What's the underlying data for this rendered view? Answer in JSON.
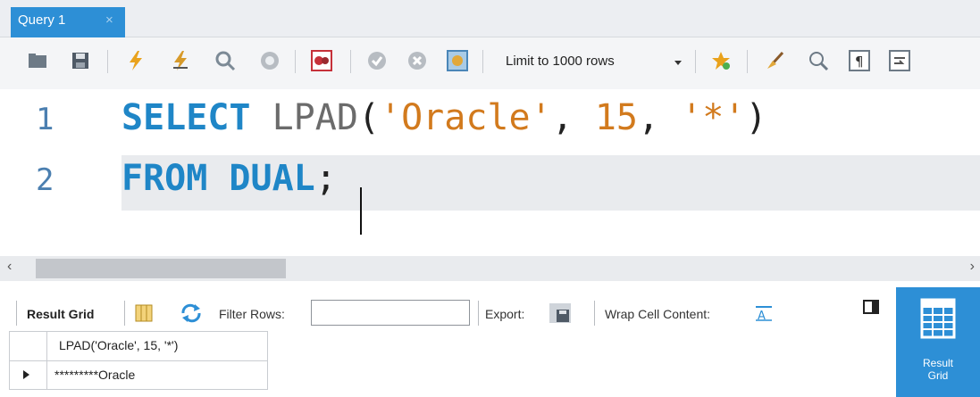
{
  "tab": {
    "title": "Query 1",
    "close_glyph": "×"
  },
  "toolbar": {
    "icons": [
      "folder-open-icon",
      "save-icon",
      "execute-icon",
      "execute-current-icon",
      "explain-icon",
      "stop-icon",
      "toggle-error-icon",
      "commit-icon",
      "rollback-icon",
      "autocommit-icon",
      "favorite-snippet-icon",
      "beautify-icon",
      "find-icon",
      "invisible-chars-icon",
      "wrap-icon"
    ],
    "limit_select": "Limit to 1000 rows"
  },
  "editor": {
    "lines": [
      {
        "number": "1",
        "kw1": "SELECT",
        "fn": "LPAD",
        "p1": "(",
        "s1": "'Oracle'",
        "c1": ", ",
        "n1": "15",
        "c2": ", ",
        "s2": "'*'",
        "p2": ")"
      },
      {
        "number": "2",
        "kw1": "FROM",
        "kw2": "DUAL",
        "p1": ";"
      }
    ]
  },
  "scrollbar": {
    "left_arrow": "‹",
    "right_arrow": "›"
  },
  "result_toolbar": {
    "result_grid_label": "Result Grid",
    "filter_label": "Filter Rows:",
    "filter_value": "",
    "export_label": "Export:",
    "wrap_label": "Wrap Cell Content:"
  },
  "result_grid": {
    "columns": [
      "LPAD('Oracle', 15, '*')"
    ],
    "rows": [
      [
        "*********Oracle"
      ]
    ]
  },
  "side_panel": {
    "label_line1": "Result",
    "label_line2": "Grid"
  },
  "colors": {
    "accent": "#2d8fd6",
    "keyword": "#1f86c7",
    "string": "#d27a1d"
  }
}
